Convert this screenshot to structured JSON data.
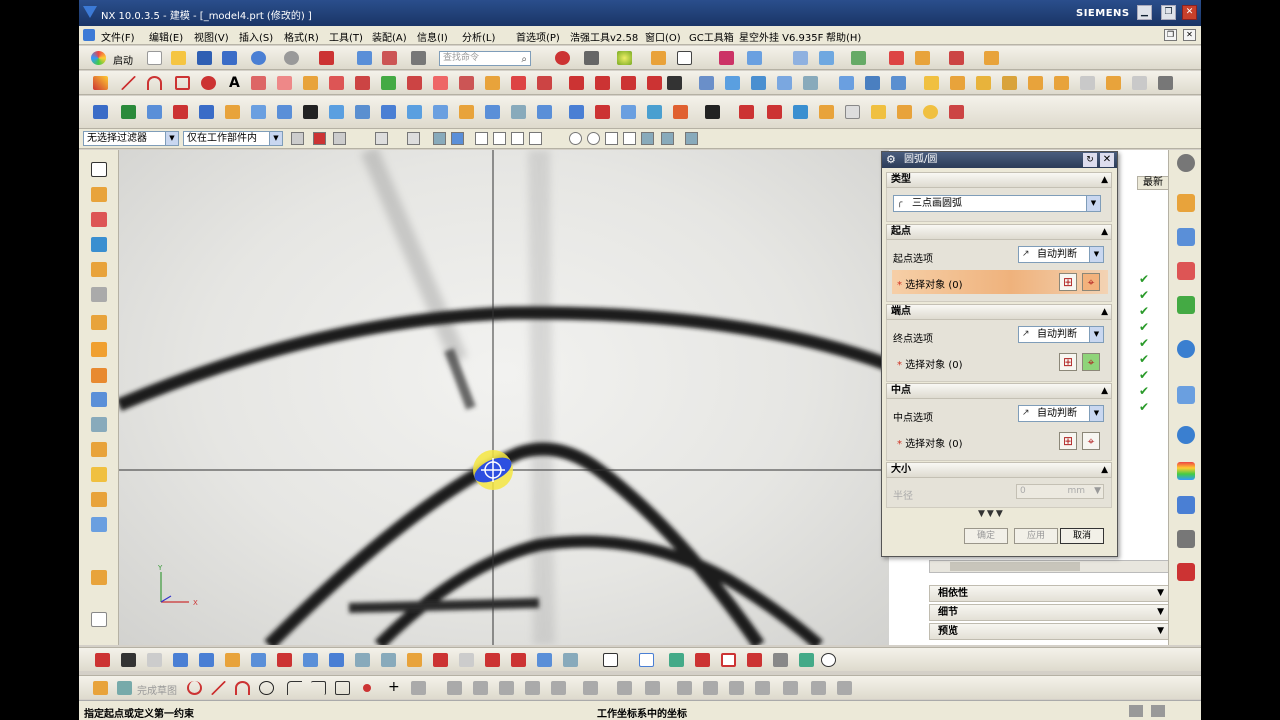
{
  "window": {
    "title": "NX 10.0.3.5 - 建模 - [_model4.prt  (修改的)  ]",
    "brand": "SIEMENS",
    "buttons": {
      "minimize": "▁",
      "restore": "❐",
      "close": "✕"
    }
  },
  "menu": {
    "items": [
      "文件(F)",
      "编辑(E)",
      "视图(V)",
      "插入(S)",
      "格式(R)",
      "工具(T)",
      "装配(A)",
      "信息(I)",
      "分析(L)",
      "首选项(P)",
      "浩强工具v2.58",
      "窗口(O)",
      "GC工具箱",
      "星空外挂 V6.935F",
      "帮助(H)"
    ]
  },
  "toolbar": {
    "start_label": "启动",
    "search_placeholder": "查找命令",
    "search_icon": "search-icon"
  },
  "selection_bar": {
    "filter_value": "无选择过滤器",
    "scope_value": "仅在工作部件内"
  },
  "navigator": {
    "column_latest": "最新",
    "checks": [
      "✔",
      "✔",
      "✔",
      "✔",
      "✔",
      "✔",
      "✔",
      "✔",
      "✔"
    ],
    "panels": [
      {
        "label": "相依性",
        "chevron": "▼"
      },
      {
        "label": "细节",
        "chevron": "▼"
      },
      {
        "label": "预览",
        "chevron": "▼"
      }
    ]
  },
  "dialog": {
    "title": "圆弧/圆",
    "reset_icon": "↻",
    "close_icon": "✕",
    "section_type": "类型",
    "type_value": "三点画圆弧",
    "section_start": "起点",
    "start_option_label": "起点选项",
    "start_option_value": "自动判断",
    "start_select_label": "选择对象 (0)",
    "section_end": "端点",
    "end_option_label": "终点选项",
    "end_option_value": "自动判断",
    "end_select_label": "选择对象 (0)",
    "section_mid": "中点",
    "mid_option_label": "中点选项",
    "mid_option_value": "自动判断",
    "mid_select_label": "选择对象 (0)",
    "section_size": "大小",
    "radius_label": "半径",
    "radius_value": "0",
    "radius_unit": "mm",
    "more_indicator": "▼▼▼",
    "ok_label": "确定",
    "apply_label": "应用",
    "cancel_label": "取消"
  },
  "bottom_toolbar": {
    "finish_sketch_label": "完成草图"
  },
  "status": {
    "prompt": "指定起点或定义第一约束",
    "coord_info": "工作坐标系中的坐标"
  },
  "colors": {
    "title_bar": "#2a4e8c",
    "active_selection": "#efb27c",
    "checkmark": "#2a9a2a",
    "brand": "#ffffff"
  }
}
